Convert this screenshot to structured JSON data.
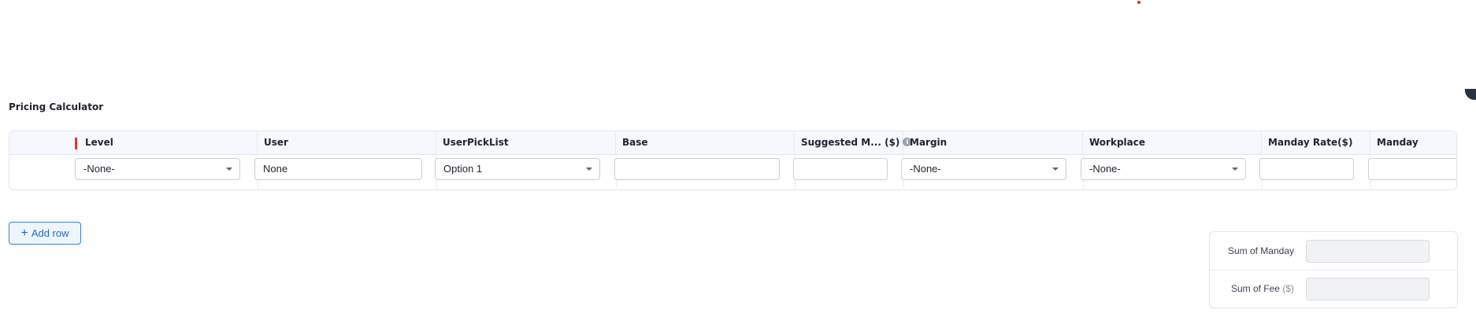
{
  "section": {
    "title": "Pricing Calculator"
  },
  "columns": [
    {
      "id": "level",
      "label": "Level",
      "required": true
    },
    {
      "id": "user",
      "label": "User"
    },
    {
      "id": "userpicklist",
      "label": "UserPickList"
    },
    {
      "id": "base",
      "label": "Base"
    },
    {
      "id": "suggested",
      "label": "Suggested M... ($)",
      "info_icon": "info-icon"
    },
    {
      "id": "margin",
      "label": "Margin"
    },
    {
      "id": "workplace",
      "label": "Workplace"
    },
    {
      "id": "manday_rate",
      "label": "Manday Rate($)"
    },
    {
      "id": "manday",
      "label": "Manday"
    }
  ],
  "row": {
    "level": "-None-",
    "user": "None",
    "userpicklist": "Option 1",
    "base": "",
    "suggested": "",
    "margin": "-None-",
    "workplace": "-None-",
    "manday_rate": "",
    "manday": ""
  },
  "actions": {
    "add_row_icon": "+",
    "add_row_label": "Add row"
  },
  "summary": {
    "sum_manday_label": "Sum of Manday",
    "sum_fee_label": "Sum of Fee",
    "sum_fee_unit": "($)",
    "sum_manday_value": "",
    "sum_fee_value": ""
  },
  "colors": {
    "accent": "#1f6bc4",
    "required": "#e8342a",
    "header_bg": "#f5f8fc"
  }
}
